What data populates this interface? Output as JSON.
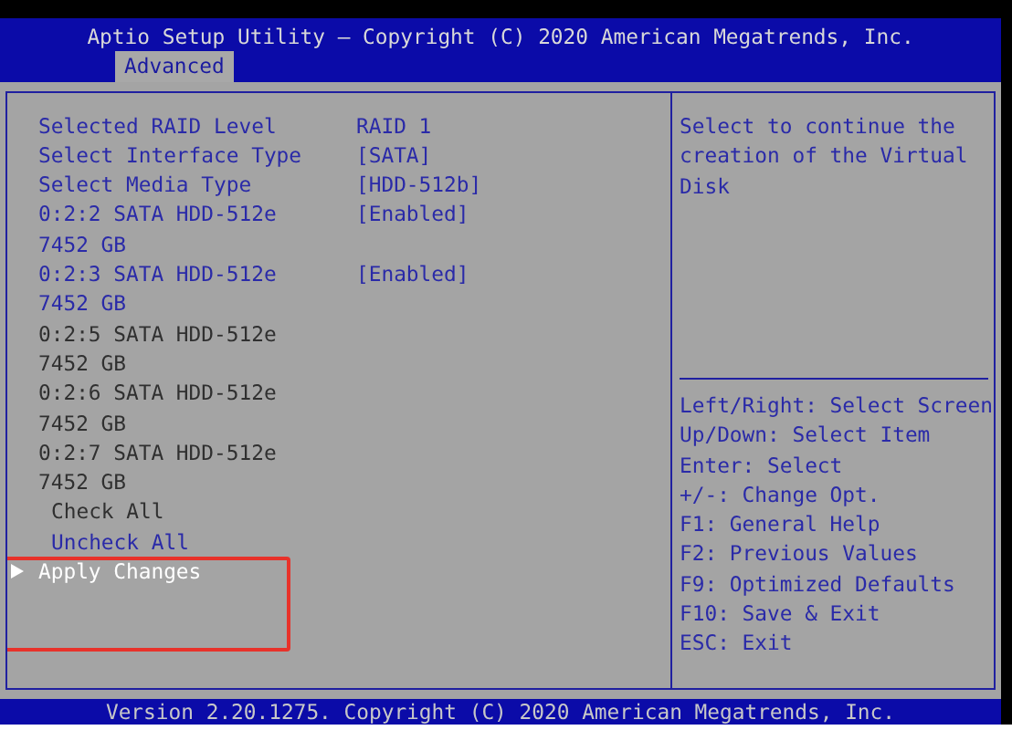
{
  "window": {
    "title": "Aptio Setup Utility – Copyright (C) 2020 American Megatrends, Inc."
  },
  "tabs": [
    {
      "label": "Advanced",
      "selected": true
    }
  ],
  "items": [
    {
      "kind": "setting",
      "label": "Selected RAID Level",
      "value": "RAID 1",
      "disabled": false,
      "selected": false,
      "annotated": false
    },
    {
      "kind": "setting",
      "label": "Select Interface Type",
      "value": "[SATA]",
      "disabled": false,
      "selected": false,
      "annotated": false
    },
    {
      "kind": "setting",
      "label": "Select Media Type",
      "value": "[HDD-512b]",
      "disabled": false,
      "selected": false,
      "annotated": false
    },
    {
      "kind": "setting",
      "label": "0:2:2 SATA HDD-512e",
      "value": "[Enabled]",
      "disabled": false,
      "selected": false,
      "annotated": false
    },
    {
      "kind": "info",
      "label": "7452 GB",
      "disabled": false,
      "selected": false,
      "annotated": false
    },
    {
      "kind": "setting",
      "label": "0:2:3 SATA HDD-512e",
      "value": "[Enabled]",
      "disabled": false,
      "selected": false,
      "annotated": false
    },
    {
      "kind": "info",
      "label": "7452 GB",
      "disabled": false,
      "selected": false,
      "annotated": false
    },
    {
      "kind": "info",
      "label": "0:2:5 SATA HDD-512e",
      "disabled": true,
      "selected": false,
      "annotated": false
    },
    {
      "kind": "info",
      "label": "7452 GB",
      "disabled": true,
      "selected": false,
      "annotated": false
    },
    {
      "kind": "info",
      "label": "0:2:6 SATA HDD-512e",
      "disabled": true,
      "selected": false,
      "annotated": false
    },
    {
      "kind": "info",
      "label": "7452 GB",
      "disabled": true,
      "selected": false,
      "annotated": false
    },
    {
      "kind": "info",
      "label": "0:2:7 SATA HDD-512e",
      "disabled": true,
      "selected": false,
      "annotated": false
    },
    {
      "kind": "info",
      "label": "7452 GB",
      "disabled": true,
      "selected": false,
      "annotated": false
    },
    {
      "kind": "action",
      "label": "Check All",
      "disabled": true,
      "selected": false,
      "annotated": false
    },
    {
      "kind": "action",
      "label": "Uncheck All",
      "disabled": false,
      "selected": false,
      "annotated": false
    },
    {
      "kind": "submenu",
      "label": "Apply Changes",
      "disabled": false,
      "selected": true,
      "annotated": true
    }
  ],
  "help": {
    "description": "Select to continue the creation of the Virtual Disk",
    "keys": [
      "Left/Right: Select Screen",
      "Up/Down: Select Item",
      "Enter: Select",
      "+/-: Change Opt.",
      "F1: General Help",
      "F2: Previous Values",
      "F9: Optimized Defaults",
      "F10: Save & Exit",
      "ESC: Exit"
    ]
  },
  "status_bar": {
    "text": "Version 2.20.1275. Copyright (C) 2020 American Megatrends, Inc."
  }
}
